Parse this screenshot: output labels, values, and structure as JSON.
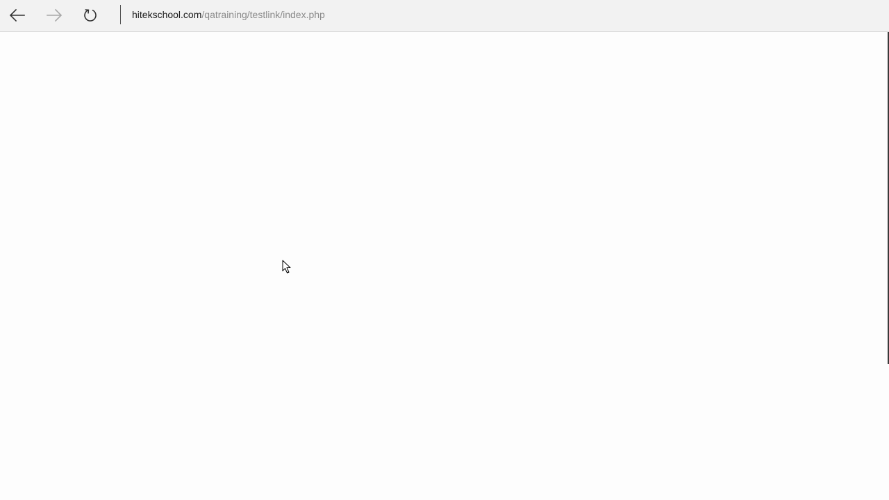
{
  "browser": {
    "address_bar": {
      "domain": "hitekschool.com",
      "path": "/qatraining/testlink/index.php"
    },
    "nav": {
      "back_icon": "arrow-left-icon",
      "forward_icon": "arrow-right-icon",
      "refresh_icon": "refresh-icon"
    },
    "colors": {
      "toolbar_bg": "#f2f2f2",
      "page_bg": "#fdfdfd",
      "url_domain": "#1b1b1b",
      "url_path": "#8a8a8a"
    }
  },
  "page": {
    "state": "blank"
  }
}
